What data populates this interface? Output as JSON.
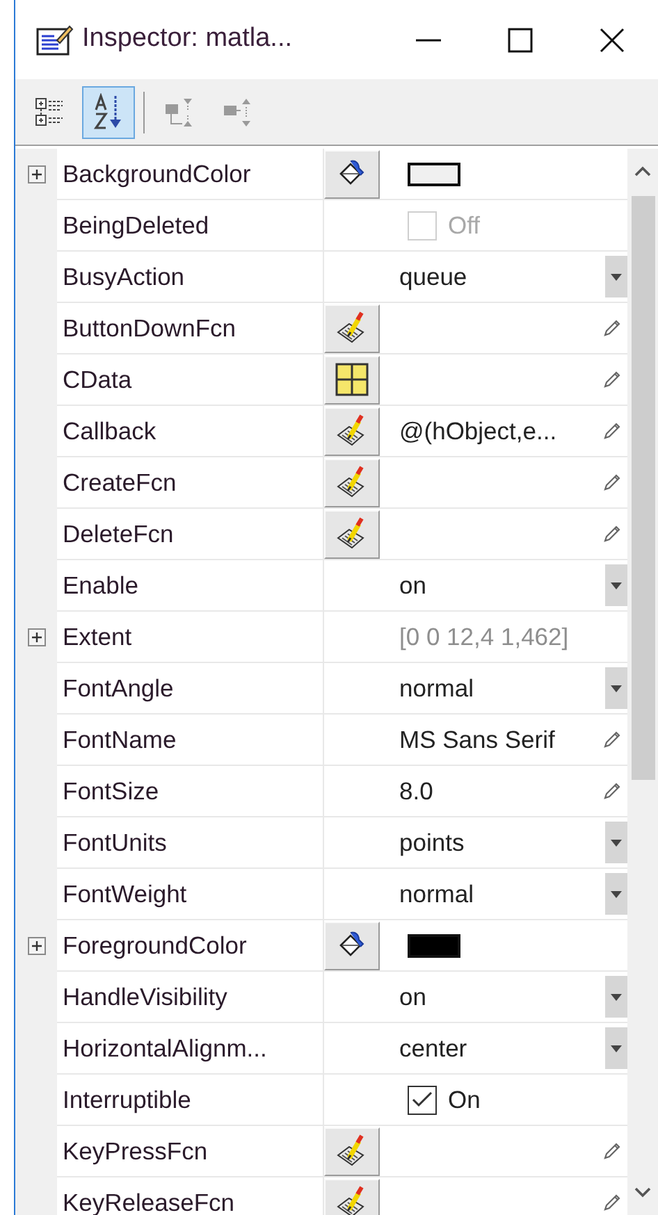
{
  "window": {
    "title": "Inspector:  matla..."
  },
  "toolbar": [
    {
      "kind": "categorized",
      "selected": false,
      "disabled": false
    },
    {
      "kind": "alphabetical",
      "selected": true,
      "disabled": false
    },
    {
      "kind": "expand",
      "selected": false,
      "disabled": true
    },
    {
      "kind": "collapse",
      "selected": false,
      "disabled": true
    }
  ],
  "properties": [
    {
      "name": "BackgroundColor",
      "expandable": true,
      "editor": {
        "kind": "color"
      },
      "value": {
        "kind": "swatch",
        "color": "#f0f0f0"
      }
    },
    {
      "name": "BeingDeleted",
      "expandable": false,
      "value": {
        "kind": "checkbox",
        "checked": false,
        "disabled": true,
        "text": "Off"
      }
    },
    {
      "name": "BusyAction",
      "expandable": false,
      "value": {
        "kind": "dropdown",
        "text": "queue"
      }
    },
    {
      "name": "ButtonDownFcn",
      "expandable": false,
      "editor": {
        "kind": "callback"
      },
      "value": {
        "kind": "text",
        "editable": true
      }
    },
    {
      "name": "CData",
      "expandable": false,
      "editor": {
        "kind": "matrix"
      },
      "value": {
        "kind": "text",
        "editable": true
      }
    },
    {
      "name": "Callback",
      "expandable": false,
      "editor": {
        "kind": "callback"
      },
      "value": {
        "kind": "text",
        "text": "@(hObject,e...",
        "editable": true
      }
    },
    {
      "name": "CreateFcn",
      "expandable": false,
      "editor": {
        "kind": "callback"
      },
      "value": {
        "kind": "text",
        "editable": true
      }
    },
    {
      "name": "DeleteFcn",
      "expandable": false,
      "editor": {
        "kind": "callback"
      },
      "value": {
        "kind": "text",
        "editable": true
      }
    },
    {
      "name": "Enable",
      "expandable": false,
      "value": {
        "kind": "dropdown",
        "text": "on"
      }
    },
    {
      "name": "Extent",
      "expandable": true,
      "value": {
        "kind": "readonly",
        "text": "[0 0 12,4 1,462]"
      }
    },
    {
      "name": "FontAngle",
      "expandable": false,
      "value": {
        "kind": "dropdown",
        "text": "normal"
      }
    },
    {
      "name": "FontName",
      "expandable": false,
      "value": {
        "kind": "text",
        "text": "MS Sans Serif",
        "editable": true
      }
    },
    {
      "name": "FontSize",
      "expandable": false,
      "value": {
        "kind": "text",
        "text": "8.0",
        "editable": true
      }
    },
    {
      "name": "FontUnits",
      "expandable": false,
      "value": {
        "kind": "dropdown",
        "text": "points"
      }
    },
    {
      "name": "FontWeight",
      "expandable": false,
      "value": {
        "kind": "dropdown",
        "text": "normal"
      }
    },
    {
      "name": "ForegroundColor",
      "expandable": true,
      "editor": {
        "kind": "color"
      },
      "value": {
        "kind": "swatch",
        "color": "#000000"
      }
    },
    {
      "name": "HandleVisibility",
      "expandable": false,
      "value": {
        "kind": "dropdown",
        "text": "on"
      }
    },
    {
      "name": "HorizontalAlignm...",
      "expandable": false,
      "value": {
        "kind": "dropdown",
        "text": "center"
      }
    },
    {
      "name": "Interruptible",
      "expandable": false,
      "value": {
        "kind": "checkbox",
        "checked": true,
        "disabled": false,
        "text": "On"
      }
    },
    {
      "name": "KeyPressFcn",
      "expandable": false,
      "editor": {
        "kind": "callback"
      },
      "value": {
        "kind": "text",
        "editable": true
      }
    },
    {
      "name": "KeyReleaseFcn",
      "expandable": false,
      "editor": {
        "kind": "callback"
      },
      "value": {
        "kind": "text",
        "editable": true
      }
    }
  ]
}
